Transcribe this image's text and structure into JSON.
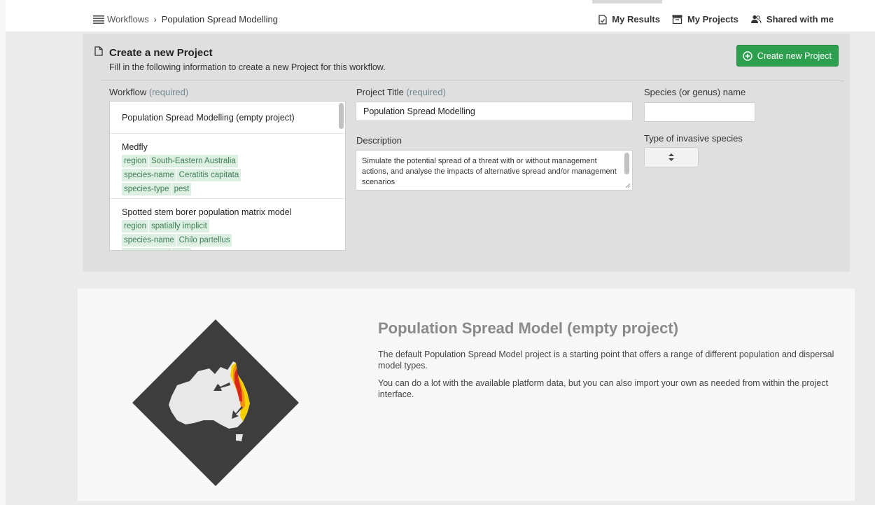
{
  "breadcrumb": {
    "workflows": "Workflows",
    "separator": "›",
    "current": "Population Spread Modelling"
  },
  "topnav": {
    "my_results": "My Results",
    "my_projects": "My Projects",
    "shared": "Shared with me"
  },
  "panel": {
    "title": "Create a new Project",
    "subtitle": "Fill in the following information to create a new Project for this workflow.",
    "create_button": "Create new Project"
  },
  "workflow": {
    "label": "Workflow",
    "required": "(required)",
    "items": [
      {
        "name": "Population Spread Modelling (empty project)"
      },
      {
        "name": "Medfly",
        "tags": [
          {
            "key": "region",
            "value": "South-Eastern Australia"
          },
          {
            "key": "species-name",
            "value": "Ceratitis capitata"
          },
          {
            "key": "species-type",
            "value": "pest"
          }
        ]
      },
      {
        "name": "Spotted stem borer population matrix model",
        "tags": [
          {
            "key": "region",
            "value": "spatially implicit"
          },
          {
            "key": "species-name",
            "value": "Chilo partellus"
          },
          {
            "key": "species-type",
            "value": "pest"
          }
        ]
      }
    ]
  },
  "project_title": {
    "label": "Project Title",
    "required": "(required)",
    "value": "Population Spread Modelling"
  },
  "description": {
    "label": "Description",
    "value": "Simulate the potential spread of a threat with or without management actions, and analyse the impacts of alternative spread and/or management scenarios"
  },
  "species": {
    "label": "Species (or genus) name",
    "value": ""
  },
  "invasive_type": {
    "label": "Type of invasive species",
    "value": ""
  },
  "info": {
    "title": "Population Spread Model (empty project)",
    "para1": "The default Population Spread Model project is a starting point that offers a range of different population and dispersal model types.",
    "para2": "You can do a lot with the available platform data, but you can also import your own as needed from within the project interface."
  },
  "colors": {
    "accent_green": "#2e9f4f",
    "tag_bg": "#dcefe2",
    "tag_text": "#3f7d56",
    "panel_bg": "#dfdfe0"
  },
  "icons": [
    "menu-icon",
    "chevron-right-icon",
    "results-doc-icon",
    "archive-box-icon",
    "shared-users-icon",
    "document-icon",
    "plus-circle-icon",
    "select-arrows-icon",
    "resize-grip-icon",
    "australia-map-icon"
  ]
}
